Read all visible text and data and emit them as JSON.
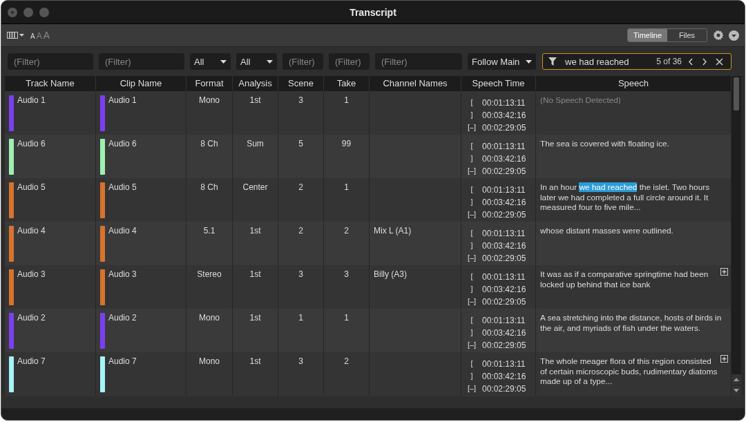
{
  "window": {
    "title": "Transcript"
  },
  "toolbar": {
    "font_sizes": [
      {
        "label": "A",
        "selected": true
      },
      {
        "label": "A",
        "selected": false
      },
      {
        "label": "A",
        "selected": false
      }
    ],
    "view_tabs": [
      {
        "label": "Timeline",
        "selected": true
      },
      {
        "label": "Files",
        "selected": false
      }
    ]
  },
  "filters": [
    {
      "kind": "text",
      "placeholder": "(Filter)"
    },
    {
      "kind": "text",
      "placeholder": "(Filter)"
    },
    {
      "kind": "dropdown",
      "value": "All"
    },
    {
      "kind": "dropdown",
      "value": "All"
    },
    {
      "kind": "text",
      "placeholder": "(Filter)"
    },
    {
      "kind": "text",
      "placeholder": "(Filter)"
    },
    {
      "kind": "text",
      "placeholder": "(Filter)"
    },
    {
      "kind": "dropdown",
      "value": "Follow Main"
    }
  ],
  "search": {
    "value": "we had reached",
    "count": "5 of 36"
  },
  "table": {
    "columns": [
      "Track Name",
      "Clip Name",
      "Format",
      "Analysis",
      "Scene",
      "Take",
      "Channel Names",
      "Speech Time",
      "Speech"
    ],
    "rows": [
      {
        "track": {
          "name": "Audio 1",
          "color": "#7b3ff2"
        },
        "clip": {
          "name": "Audio 1",
          "color": "#7b3ff2"
        },
        "format": "Mono",
        "analysis": "1st",
        "scene": "3",
        "take": "1",
        "times": [
          {
            "mark": "[",
            "time": "00:01:13:11"
          },
          {
            "mark": "]",
            "time": "00:03:42:16"
          },
          {
            "mark": "[–]",
            "time": "00:02:29:05"
          }
        ],
        "speech": [
          {
            "kind": "placeholder",
            "text": "(No Speech Detected)"
          }
        ],
        "expandable": false
      },
      {
        "track": {
          "name": "Audio 6",
          "color": "#9ef0b0"
        },
        "clip": {
          "name": "Audio 6",
          "color": "#9ef0b0"
        },
        "format": "8 Ch",
        "analysis": "Sum",
        "scene": "5",
        "take": "99",
        "times": [
          {
            "mark": "[",
            "time": "00:01:13:11"
          },
          {
            "mark": "]",
            "time": "00:03:42:16"
          },
          {
            "mark": "[–]",
            "time": "00:02:29:05"
          }
        ],
        "speech": [
          {
            "kind": "plain",
            "text": "The sea is covered with floating ice."
          }
        ],
        "expandable": false
      },
      {
        "track": {
          "name": "Audio 5",
          "color": "#d7742e"
        },
        "clip": {
          "name": "Audio 5",
          "color": "#d7742e"
        },
        "format": "8 Ch",
        "analysis": "Center",
        "scene": "2",
        "take": "1",
        "times": [
          {
            "mark": "[",
            "time": "00:01:13:11"
          },
          {
            "mark": "]",
            "time": "00:03:42:16"
          },
          {
            "mark": "[–]",
            "time": "00:02:29:05"
          }
        ],
        "speech": [
          {
            "kind": "plain",
            "text": "In an hour "
          },
          {
            "kind": "match",
            "text": "we had reached"
          },
          {
            "kind": "plain",
            "text": " the islet. Two hours later we had completed a full circle around it. It measured four to five mile..."
          }
        ],
        "expandable": false
      },
      {
        "track": {
          "name": "Audio 4",
          "color": "#d7742e"
        },
        "clip": {
          "name": "Audio 4",
          "color": "#d7742e"
        },
        "format": "5.1",
        "analysis": "1st",
        "scene": "2",
        "take": "2",
        "channels": "Mix L (A1)",
        "times": [
          {
            "mark": "[",
            "time": "00:01:13:11"
          },
          {
            "mark": "]",
            "time": "00:03:42:16"
          },
          {
            "mark": "[–]",
            "time": "00:02:29:05"
          }
        ],
        "speech": [
          {
            "kind": "plain",
            "text": "whose distant masses were outlined."
          }
        ],
        "expandable": false
      },
      {
        "track": {
          "name": "Audio 3",
          "color": "#d7742e"
        },
        "clip": {
          "name": "Audio 3",
          "color": "#d7742e"
        },
        "format": "Stereo",
        "analysis": "1st",
        "scene": "3",
        "take": "3",
        "channels": "Billy (A3)",
        "times": [
          {
            "mark": "[",
            "time": "00:01:13:11"
          },
          {
            "mark": "]",
            "time": "00:03:42:16"
          },
          {
            "mark": "[–]",
            "time": "00:02:29:05"
          }
        ],
        "speech": [
          {
            "kind": "plain",
            "text": "It was as if a comparative springtime had been locked up behind that ice bank"
          }
        ],
        "expandable": true
      },
      {
        "track": {
          "name": "Audio 2",
          "color": "#7b3ff2"
        },
        "clip": {
          "name": "Audio 2",
          "color": "#7b3ff2"
        },
        "format": "Mono",
        "analysis": "1st",
        "scene": "1",
        "take": "1",
        "times": [
          {
            "mark": "[",
            "time": "00:01:13:11"
          },
          {
            "mark": "]",
            "time": "00:03:42:16"
          },
          {
            "mark": "[–]",
            "time": "00:02:29:05"
          }
        ],
        "speech": [
          {
            "kind": "plain",
            "text": "A sea stretching into the distance, hosts of birds in the air, and myriads of fish under the waters."
          }
        ],
        "expandable": false
      },
      {
        "track": {
          "name": "Audio 7",
          "color": "#a6f4f8"
        },
        "clip": {
          "name": "Audio 7",
          "color": "#a6f4f8"
        },
        "format": "Mono",
        "analysis": "1st",
        "scene": "3",
        "take": "2",
        "times": [
          {
            "mark": "[",
            "time": "00:01:13:11"
          },
          {
            "mark": "]",
            "time": "00:03:42:16"
          },
          {
            "mark": "[–]",
            "time": "00:02:29:05"
          }
        ],
        "speech": [
          {
            "kind": "plain",
            "text": "The whole meager flora of this region consisted of certain microscopic buds, rudimentary diatoms made up of a type..."
          }
        ],
        "expandable": true
      }
    ]
  }
}
